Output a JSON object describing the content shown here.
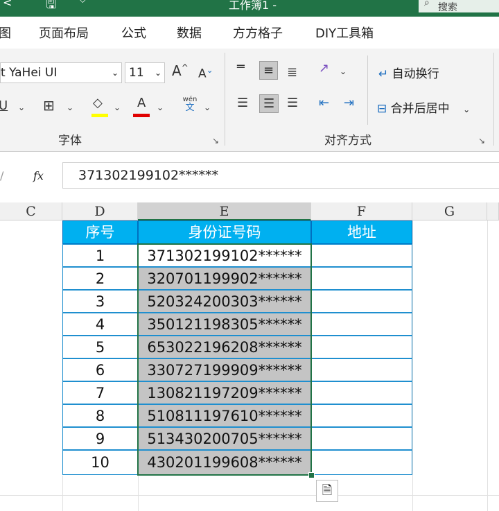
{
  "titlebar": {
    "back_glyph": "<",
    "save_icon": "save-icon",
    "title": "工作簿1 -",
    "search_placeholder": "搜索"
  },
  "tabs": [
    "图",
    "页面布局",
    "公式",
    "数据",
    "方方格子",
    "DIY工具箱"
  ],
  "ribbon": {
    "font_name": "t YaHei UI",
    "font_size": "11",
    "grow_font": "A",
    "shrink_font": "A",
    "underline": "U",
    "wrap_text": "自动换行",
    "merge_center": "合并后居中",
    "phonetic_top": "wén",
    "phonetic_bottom": "文",
    "group_font": "字体",
    "group_alignment": "对齐方式",
    "fill_color": "#ffff00",
    "font_color": "#e00000"
  },
  "formula_bar": {
    "fx": "fx",
    "value": "371302199102******"
  },
  "columns": [
    "C",
    "D",
    "E",
    "F",
    "G"
  ],
  "table": {
    "headers": [
      "序号",
      "身份证号码",
      "地址"
    ],
    "rows": [
      {
        "no": "1",
        "id": "371302199102******"
      },
      {
        "no": "2",
        "id": "320701199902******"
      },
      {
        "no": "3",
        "id": "520324200303******"
      },
      {
        "no": "4",
        "id": "350121198305******"
      },
      {
        "no": "5",
        "id": "653022196208******"
      },
      {
        "no": "6",
        "id": "330727199909******"
      },
      {
        "no": "7",
        "id": "130821197209******"
      },
      {
        "no": "8",
        "id": "510811197610******"
      },
      {
        "no": "9",
        "id": "513430200705******"
      },
      {
        "no": "10",
        "id": "430201199608******"
      }
    ],
    "header_color": "#00b0f0",
    "selection_color": "#217346"
  }
}
